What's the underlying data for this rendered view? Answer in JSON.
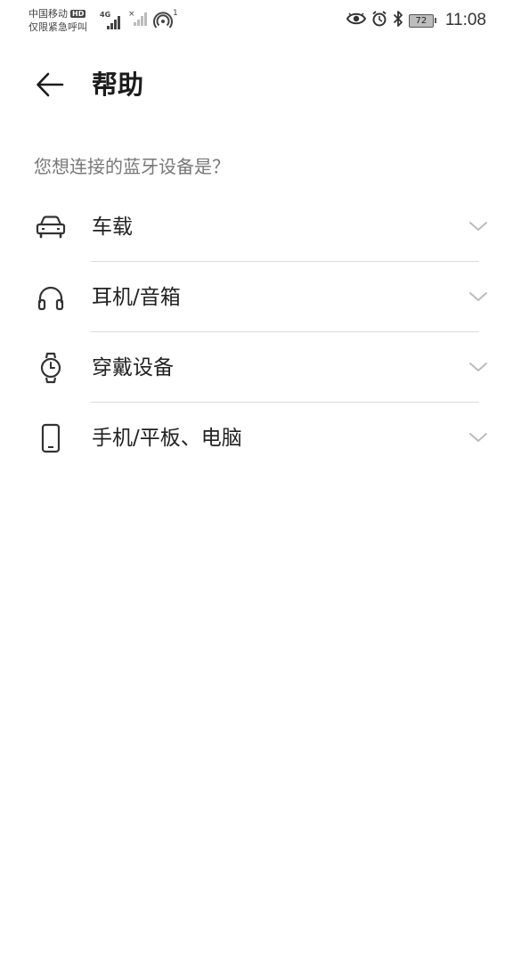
{
  "status_bar": {
    "carrier": "中国移动",
    "hd_badge": "HD",
    "network_type": "4G",
    "emergency": "仅限紧急呼叫",
    "hotspot_count": "1",
    "battery": "72",
    "time": "11:08",
    "icons": [
      "signal-icon",
      "no-signal-icon",
      "hotspot-icon",
      "eye-icon",
      "alarm-icon",
      "bluetooth-icon",
      "battery-icon"
    ]
  },
  "header": {
    "title": "帮助",
    "back_icon": "arrow-left-icon"
  },
  "question": "您想连接的蓝牙设备是？",
  "devices": [
    {
      "label": "车载",
      "icon": "car-icon"
    },
    {
      "label": "耳机/音箱",
      "icon": "headphones-icon"
    },
    {
      "label": "穿戴设备",
      "icon": "watch-icon"
    },
    {
      "label": "手机/平板、电脑",
      "icon": "phone-icon"
    }
  ],
  "colors": {
    "background": "#ffffff",
    "text_primary": "#222222",
    "text_secondary": "#777777",
    "divider": "#dcdcdc",
    "chevron": "#bbbbbb"
  }
}
